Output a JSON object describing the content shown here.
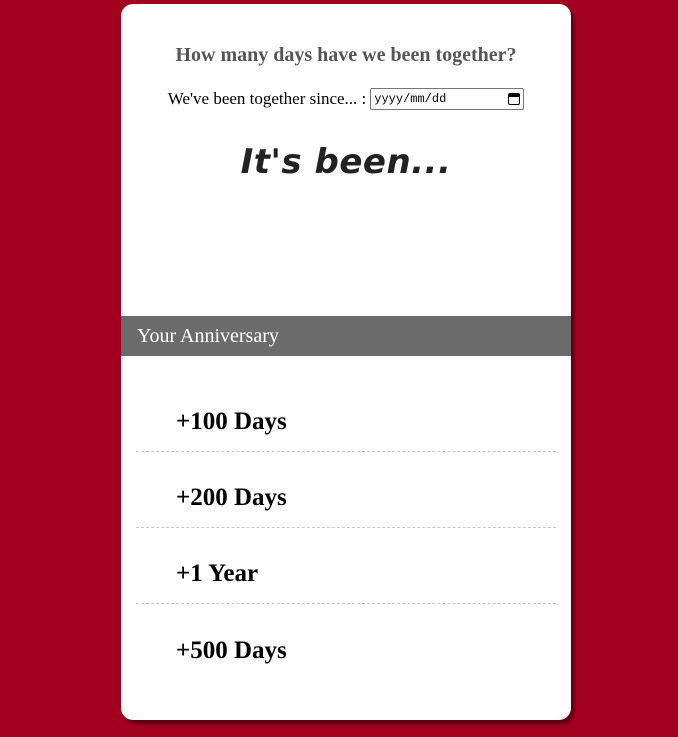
{
  "header": {
    "title": "How many days have we been together?"
  },
  "date_form": {
    "label": "We've been together since... :",
    "placeholder": "yyyy/mm/dd",
    "icon": "calendar-icon"
  },
  "result": {
    "text": "It's been..."
  },
  "anniversary": {
    "heading": "Your Anniversary",
    "items": [
      {
        "label": "+100 Days"
      },
      {
        "label": "+200 Days"
      },
      {
        "label": "+1 Year"
      },
      {
        "label": "+500 Days"
      }
    ]
  },
  "colors": {
    "background": "#a30020",
    "card": "#ffffff",
    "section_header": "#6b6b6b",
    "title_text": "#555555"
  }
}
